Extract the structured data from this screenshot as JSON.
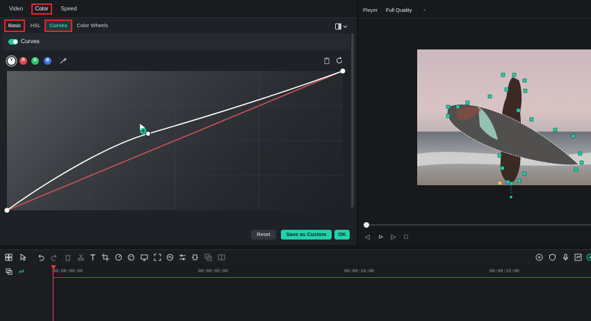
{
  "tabs": {
    "video": "Video",
    "color": "Color",
    "speed": "Speed"
  },
  "subtabs": {
    "basic": "Basic",
    "hsl": "HSL",
    "curves": "Curves",
    "wheels": "Color Wheels"
  },
  "section": {
    "title": "Curves",
    "enabled": true
  },
  "channels": [
    {
      "letter": "Y",
      "color": "#ffffff"
    },
    {
      "letter": "R",
      "color": "#e04a4f"
    },
    {
      "letter": "G",
      "color": "#2fbf6f"
    },
    {
      "letter": "B",
      "color": "#3a74e0"
    }
  ],
  "buttons": {
    "reset": "Reset",
    "save": "Save as Custom",
    "ok": "OK"
  },
  "player": {
    "label": "Player",
    "quality": "Full Quality"
  },
  "timeline": {
    "timecodes": [
      "00:00:00:00",
      "00:00:05:00",
      "00:00:10:00",
      "00:00:15:00"
    ]
  },
  "colors": {
    "accent": "#22d1ac",
    "highlight_box": "#e2262b",
    "playhead": "#e0393f"
  }
}
